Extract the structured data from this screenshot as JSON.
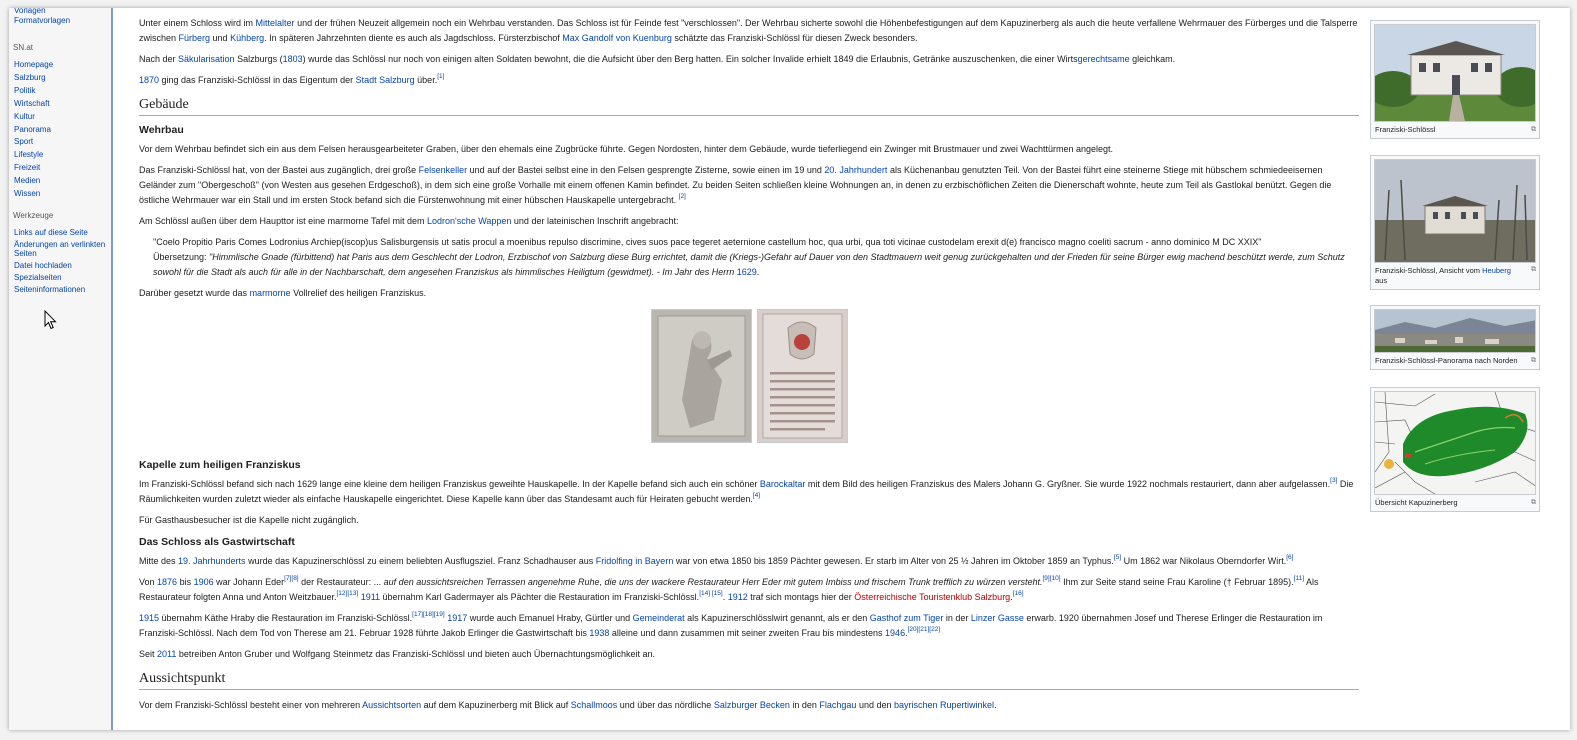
{
  "sidebar": {
    "top_items": [
      "Vorlagen",
      "Formatvorlagen"
    ],
    "sn_heading": "SN.at",
    "sn_items": [
      "Homepage",
      "Salzburg",
      "Politik",
      "Wirtschaft",
      "Kultur",
      "Panorama",
      "Sport",
      "Lifestyle",
      "Freizeit",
      "Medien",
      "Wissen"
    ],
    "tools_heading": "Werkzeuge",
    "tools_items": [
      "Links auf diese Seite",
      "Änderungen an verlinkten Seiten",
      "Datei hochladen",
      "Spezialseiten",
      "Seiteninformationen"
    ]
  },
  "article": {
    "p1": [
      {
        "t": "Unter einem Schloss wird im "
      },
      {
        "t": "Mittelalter",
        "link": true
      },
      {
        "t": " und der frühen Neuzeit allgemein noch ein Wehrbau verstanden. Das Schloss ist für Feinde fest \"verschlossen\". Der Wehrbau sicherte sowohl die Höhenbefestigungen auf dem Kapuzinerberg als auch die heute verfallene Wehrmauer des Fürberges und die Talsperre zwischen "
      },
      {
        "t": "Fürberg",
        "link": true
      },
      {
        "t": " und "
      },
      {
        "t": "Kühberg",
        "link": true
      },
      {
        "t": ". In späteren Jahrzehnten diente es auch als Jagdschloss. Fürsterzbischof "
      },
      {
        "t": "Max Gandolf von Kuenburg",
        "link": true
      },
      {
        "t": " schätzte das Franziski-Schlössl für diesen Zweck besonders."
      }
    ],
    "p2": [
      {
        "t": "Nach der "
      },
      {
        "t": "Säkularisation",
        "link": true
      },
      {
        "t": " Salzburgs ("
      },
      {
        "t": "1803",
        "link": true
      },
      {
        "t": ") wurde das Schlössl nur noch von einigen alten Soldaten bewohnt, die die Aufsicht über den Berg hatten. Ein solcher Invalide erhielt 1849 die Erlaubnis, Getränke auszuschenken, die einer Wirts"
      },
      {
        "t": "gerechtsame",
        "link": true
      },
      {
        "t": " gleichkam."
      }
    ],
    "p3": [
      {
        "t": "1870",
        "link": true
      },
      {
        "t": " ging das Franziski-Schlössl in das Eigentum der "
      },
      {
        "t": "Stadt Salzburg",
        "link": true
      },
      {
        "t": " über."
      },
      {
        "t": "[1]",
        "sup": true
      }
    ],
    "h_gebaeude": "Gebäude",
    "h_wehrbau": "Wehrbau",
    "p4": [
      {
        "t": "Vor dem Wehrbau befindet sich ein aus dem Felsen herausgearbeiteter Graben, über den ehemals eine Zugbrücke führte. Gegen Nordosten, hinter dem Gebäude, wurde tieferliegend ein Zwinger mit Brustmauer und zwei Wachttürmen angelegt."
      }
    ],
    "p5": [
      {
        "t": "Das Franziski-Schlössl hat, von der Bastei aus zugänglich, drei große "
      },
      {
        "t": "Felsenkeller",
        "link": true
      },
      {
        "t": " und auf der Bastei selbst eine in den Felsen gesprengte Zisterne, sowie einen im 19 und "
      },
      {
        "t": "20. Jahrhundert",
        "link": true
      },
      {
        "t": " als Küchenanbau genutzten Teil. Von der Bastei führt eine steinerne Stiege mit hübschem schmiedeeisernen Geländer zum \"Obergeschoß\" (von Westen aus gesehen Erdgeschoß), in dem sich eine große Vorhalle mit einem offenen Kamin befindet. Zu beiden Seiten schließen kleine Wohnungen an, in denen zu erzbischöflichen Zeiten die Dienerschaft wohnte, heute zum Teil als Gastlokal benützt. Gegen die östliche Wehrmauer war ein Stall und im ersten Stock befand sich die Fürstenwohnung mit einer hübschen Hauskapelle untergebracht. "
      },
      {
        "t": "[2]",
        "sup": true
      }
    ],
    "p6": [
      {
        "t": "Am Schlössl außen über dem Haupttor ist eine marmorne Tafel mit dem "
      },
      {
        "t": "Lodron'sche Wappen",
        "link": true
      },
      {
        "t": " und der lateinischen Inschrift angebracht:"
      }
    ],
    "quote1": "\"Coelo Propitio Paris Comes Lodronius Archiep(iscop)us Salisburgensis ut satis procul a moenibus repulso discrimine, cives suos pace tegeret aeternione castellum hoc, qua urbi, qua toti vicinae custodelam erexit d(e) francisco magno coeliti sacrum - anno dominico M DC XXIX\"",
    "quote2_label": "Übersetzung: ",
    "quote2_italic": "\"Himmlische Gnade (fürbittend) hat Paris aus dem Geschlecht der Lodron, Erzbischof von Salzburg diese Burg errichtet, damit die (Kriegs-)Gefahr auf Dauer von den Stadtmauern weit genug zurückgehalten und der Frieden für seine Bürger ewig machend beschützt werde, zum Schutz sowohl für die Stadt als auch für alle in der Nachbarschaft, dem angesehen Franziskus als himmlisches Heiligtum (gewidmet). - Im Jahr des Herrn ",
    "quote2_year": "1629",
    "p7": [
      {
        "t": "Darüber gesetzt wurde das "
      },
      {
        "t": "marmorne",
        "link": true
      },
      {
        "t": " Vollrelief des heiligen Franziskus."
      }
    ],
    "h_kapelle": "Kapelle zum heiligen Franziskus",
    "p8": [
      {
        "t": "Im Franziski-Schlössl befand sich nach 1629 lange eine kleine dem heiligen Franziskus geweihte Hauskapelle. In der Kapelle befand sich auch ein schöner "
      },
      {
        "t": "Barockaltar",
        "link": true
      },
      {
        "t": " mit dem Bild des heiligen Franziskus des Malers Johann G. Gryßner. Sie wurde 1922 nochmals restauriert, dann aber aufgelassen."
      },
      {
        "t": "[3]",
        "sup": true
      },
      {
        "t": " Die Räumlichkeiten wurden zuletzt wieder als einfache Hauskapelle eingerichtet. Diese Kapelle kann über das Standesamt auch für Heiraten gebucht werden."
      },
      {
        "t": "[4]",
        "sup": true
      }
    ],
    "p9": [
      {
        "t": "Für Gasthausbesucher ist die Kapelle nicht zugänglich."
      }
    ],
    "h_gast": "Das Schloss als Gastwirtschaft",
    "p10": [
      {
        "t": "Mitte des "
      },
      {
        "t": "19. Jahrhunderts",
        "link": true
      },
      {
        "t": " wurde das Kapuzinerschlössl zu einem beliebten Ausflugsziel. Franz Schadhauser aus "
      },
      {
        "t": "Fridolfing",
        "link": true
      },
      {
        "t": " "
      },
      {
        "t": "in Bayern",
        "link": true
      },
      {
        "t": " war von etwa 1850 bis 1859 Pächter gewesen. Er starb im Alter von 25 ½ Jahren im Oktober 1859 an Typhus."
      },
      {
        "t": "[5]",
        "sup": true
      },
      {
        "t": " Um 1862 war Nikolaus Oberndorfer Wirt."
      },
      {
        "t": "[6]",
        "sup": true
      }
    ],
    "p11": [
      {
        "t": "Von "
      },
      {
        "t": "1876",
        "link": true
      },
      {
        "t": " bis "
      },
      {
        "t": "1906",
        "link": true
      },
      {
        "t": " war Johann Eder"
      },
      {
        "t": "[7][8]",
        "sup": true
      },
      {
        "t": " der Restaurateur: ... "
      },
      {
        "t": "auf den aussichtsreichen Terrassen angenehme Ruhe, die uns der wackere Restaurateur Herr Eder mit gutem Imbiss und frischem Trunk trefflich zu würzen versteht.",
        "italic": true
      },
      {
        "t": "[9][10]",
        "sup": true
      },
      {
        "t": " Ihm zur Seite stand seine Frau Karoline († Februar 1895)."
      },
      {
        "t": "[11]",
        "sup": true
      },
      {
        "t": " Als Restaurateur folgten Anna und Anton Weitzbauer."
      },
      {
        "t": "[12][13]",
        "sup": true
      },
      {
        "t": " "
      },
      {
        "t": "1911",
        "link": true
      },
      {
        "t": " übernahm Karl Gadermayer als Pächter die Restauration im Franziski-Schlössl."
      },
      {
        "t": "[14] [15]",
        "sup": true
      },
      {
        "t": ". "
      },
      {
        "t": "1912",
        "link": true
      },
      {
        "t": " traf sich montags hier der "
      },
      {
        "t": "Österreichische Touristenklub Salzburg",
        "red": true
      },
      {
        "t": "."
      },
      {
        "t": "[16]",
        "sup": true
      }
    ],
    "p12": [
      {
        "t": "1915",
        "link": true
      },
      {
        "t": " übernahm Käthe Hraby die Restauration im Franziski-Schlössl."
      },
      {
        "t": "[17][18][19]",
        "sup": true
      },
      {
        "t": " "
      },
      {
        "t": "1917",
        "link": true
      },
      {
        "t": " wurde auch Emanuel Hraby, Gürtler und "
      },
      {
        "t": "Gemeinderat",
        "link": true
      },
      {
        "t": " als Kapuzinerschlösslwirt genannt, als er den "
      },
      {
        "t": "Gasthof zum Tiger",
        "link": true
      },
      {
        "t": " in der "
      },
      {
        "t": "Linzer Gasse",
        "link": true
      },
      {
        "t": " erwarb. 1920 übernahmen Josef und Therese Erlinger die Restauration im Franziski-Schlössl. Nach dem Tod von Therese am 21. Februar 1928 führte Jakob Erlinger die Gastwirtschaft bis "
      },
      {
        "t": "1938",
        "link": true
      },
      {
        "t": " alleine und dann zusammen mit seiner zweiten Frau bis mindestens "
      },
      {
        "t": "1946",
        "link": true
      },
      {
        "t": "."
      },
      {
        "t": "[20][21][22]",
        "sup": true
      }
    ],
    "p13": [
      {
        "t": "Seit "
      },
      {
        "t": "2011",
        "link": true
      },
      {
        "t": " betreiben Anton Gruber und Wolfgang Steinmetz das Franziski-Schlössl und bieten auch Übernachtungsmöglichkeit an."
      }
    ],
    "h_aussicht": "Aussichtspunkt",
    "p14": [
      {
        "t": "Vor dem Franziski-Schlössl besteht einer von mehreren "
      },
      {
        "t": "Aussichtsorten",
        "link": true
      },
      {
        "t": " auf dem Kapuzinerberg mit Blick auf "
      },
      {
        "t": "Schallmoos",
        "link": true
      },
      {
        "t": " und über das nördliche "
      },
      {
        "t": "Salzburger Becken",
        "link": true
      },
      {
        "t": " in den "
      },
      {
        "t": "Flachgau",
        "link": true
      },
      {
        "t": " und den "
      },
      {
        "t": "bayrischen",
        "link": true
      },
      {
        "t": " "
      },
      {
        "t": "Rupertiwinkel",
        "link": true
      },
      {
        "t": "."
      }
    ]
  },
  "thumbs": {
    "t1_caption": "Franziski-Schlössl",
    "t2_caption_a": "Franziski-Schlössl, Ansicht vom ",
    "t2_caption_link": "Heuberg",
    "t2_caption_b": " aus",
    "t3_caption": "Franziski-Schlössl-Panorama nach Norden",
    "t4_caption": "Übersicht Kapuzinerberg",
    "magnify_icon": "magnify-icon"
  },
  "colors": {
    "link": "#0645ad",
    "redlink": "#ba0000",
    "sidebar_border": "#7a9cc9"
  }
}
